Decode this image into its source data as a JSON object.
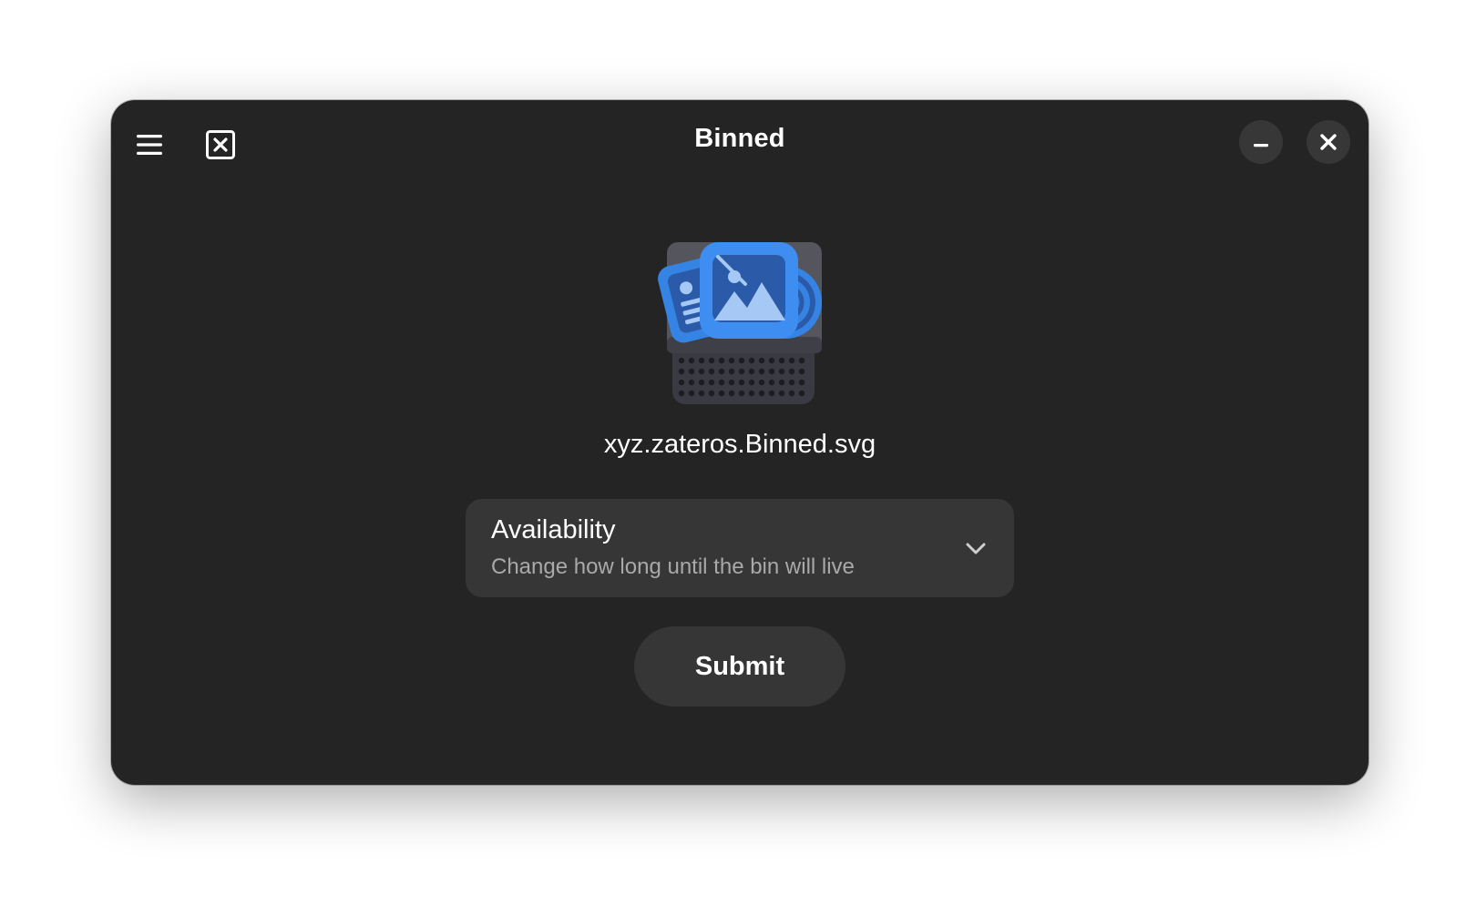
{
  "window": {
    "title": "Binned"
  },
  "headerbar": {
    "menu_icon": "hamburger-menu-icon",
    "discard_icon": "x-square-icon",
    "minimize_icon": "minimize-icon",
    "close_icon": "close-icon"
  },
  "file": {
    "name": "xyz.zateros.Binned.svg",
    "icon": "binned-app-icon"
  },
  "availability_row": {
    "title": "Availability",
    "subtitle": "Change how long until the bin will live",
    "icon": "chevron-down-icon"
  },
  "submit": {
    "label": "Submit"
  },
  "colors": {
    "window_bg": "#242424",
    "row_bg": "#363636",
    "accent_blue": "#3584e4"
  }
}
